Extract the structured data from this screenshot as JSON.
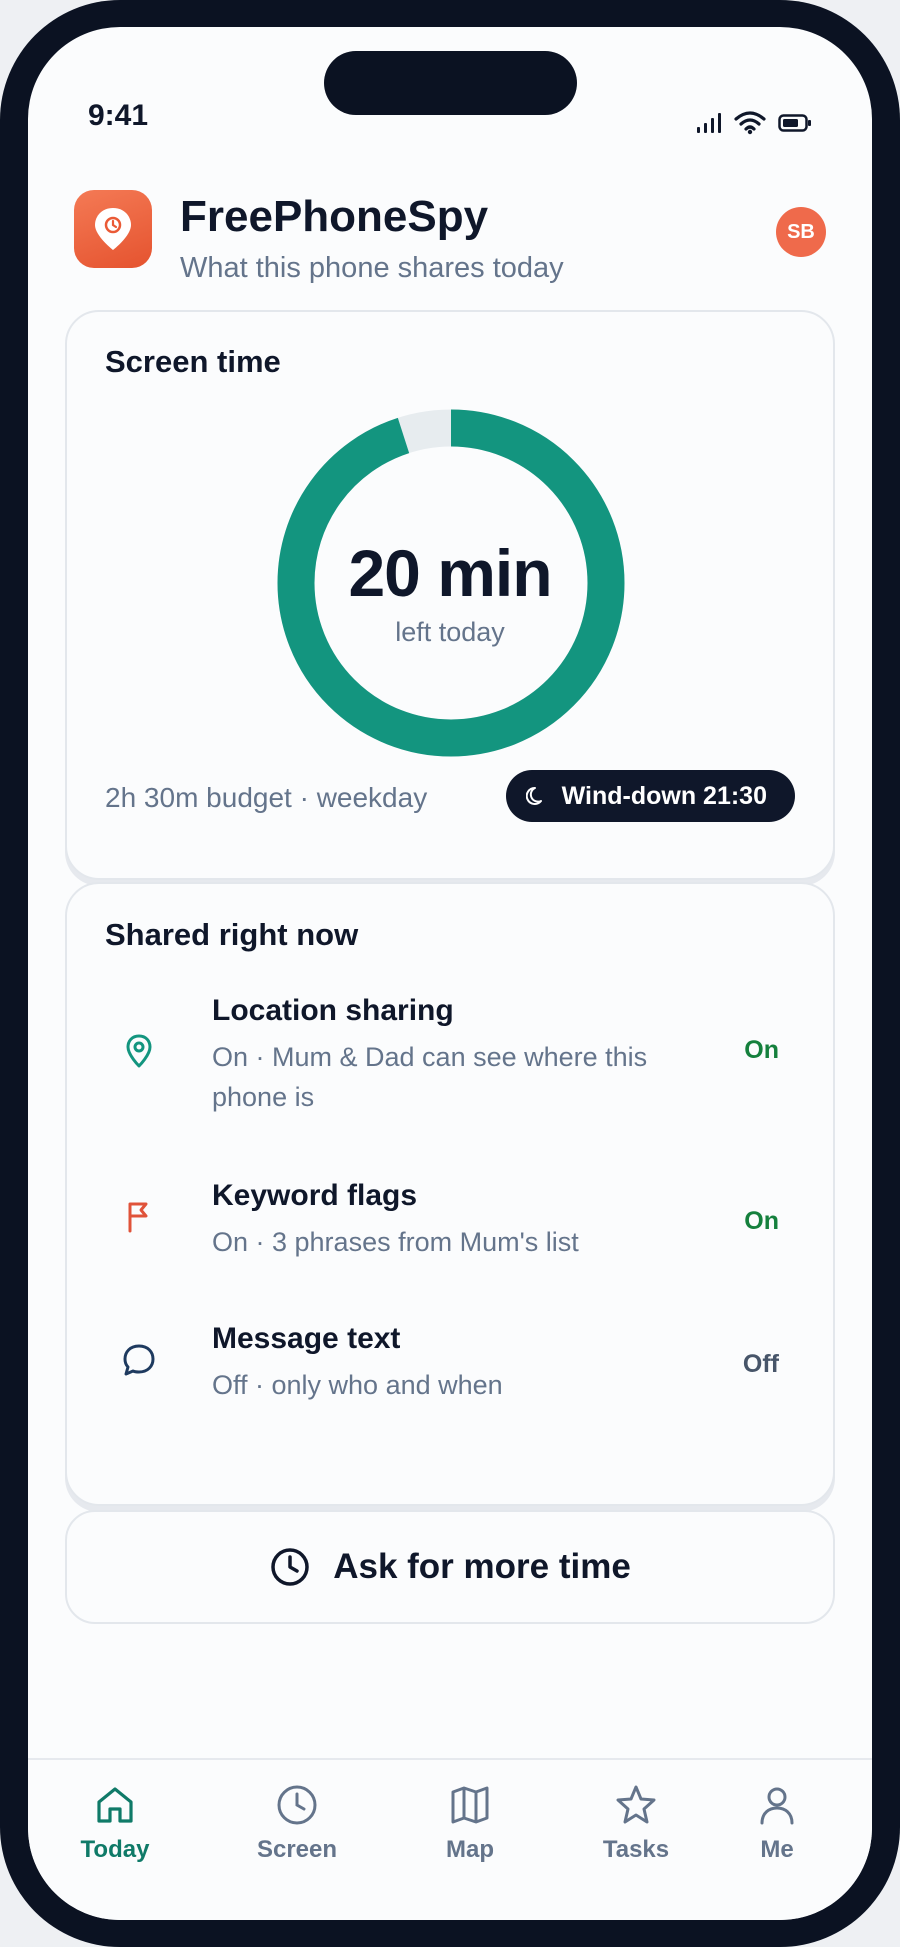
{
  "status_bar": {
    "time": "9:41"
  },
  "header": {
    "app_name": "FreePhoneSpy",
    "subtitle": "What this phone shares today",
    "avatar_initials": "SB"
  },
  "screen_time": {
    "title": "Screen time",
    "remaining_value": "20 min",
    "remaining_label": "left today",
    "progress_fraction_used": 0.95,
    "budget_text": "2h 30m budget · weekday",
    "wind_down_label": "Wind-down 21:30"
  },
  "shared_now": {
    "title": "Shared right now",
    "items": [
      {
        "title": "Location sharing",
        "description": "On · Mum & Dad can see where this phone is",
        "state": "On",
        "icon": "location-pin-icon",
        "state_color": "#15803d"
      },
      {
        "title": "Keyword flags",
        "description": "On · 3 phrases from Mum's list",
        "state": "On",
        "icon": "flag-icon",
        "state_color": "#15803d"
      },
      {
        "title": "Message text",
        "description": "Off · only who and when",
        "state": "Off",
        "icon": "chat-bubble-icon",
        "state_color": "#475569"
      }
    ]
  },
  "ask_button": {
    "label": "Ask for more time"
  },
  "tabs": [
    {
      "label": "Today",
      "icon": "home-icon",
      "active": true
    },
    {
      "label": "Screen",
      "icon": "clock-icon",
      "active": false
    },
    {
      "label": "Map",
      "icon": "map-icon",
      "active": false
    },
    {
      "label": "Tasks",
      "icon": "star-icon",
      "active": false
    },
    {
      "label": "Me",
      "icon": "person-icon",
      "active": false
    }
  ],
  "colors": {
    "accent": "#13957f",
    "brand": "#ea5a36",
    "ink": "#0f172a",
    "muted": "#64748b"
  }
}
